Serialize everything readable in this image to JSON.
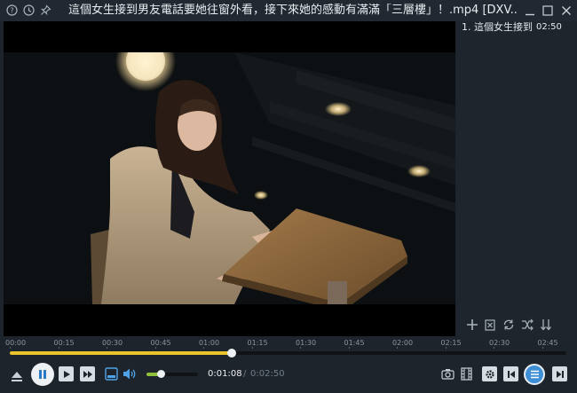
{
  "window": {
    "title": "這個女生接到男友電話要她往窗外看，接下來她的感動有滿滿「三層樓」！.mp4 [DXV..."
  },
  "playlist": {
    "items": [
      {
        "label": "1. 這個女生接到",
        "duration": "02:50"
      }
    ],
    "tools": [
      "add-icon",
      "remove-icon",
      "repeat-icon",
      "shuffle-icon",
      "sort-icon"
    ]
  },
  "timeline": {
    "ticks": [
      "00:00",
      "00:15",
      "00:30",
      "00:45",
      "01:00",
      "01:15",
      "01:30",
      "01:45",
      "02:00",
      "02:15",
      "02:30",
      "02:45"
    ],
    "progress_fraction": 0.398
  },
  "player": {
    "current_time": "0:01:08",
    "separator": "/",
    "total_time": "0:02:50",
    "volume_fraction": 0.27,
    "state": "playing"
  },
  "colors": {
    "seek_fill": "#eac32a",
    "volume_fill": "#8fc13a",
    "background": "#1e242c",
    "active_button": "#3f8fd6"
  }
}
